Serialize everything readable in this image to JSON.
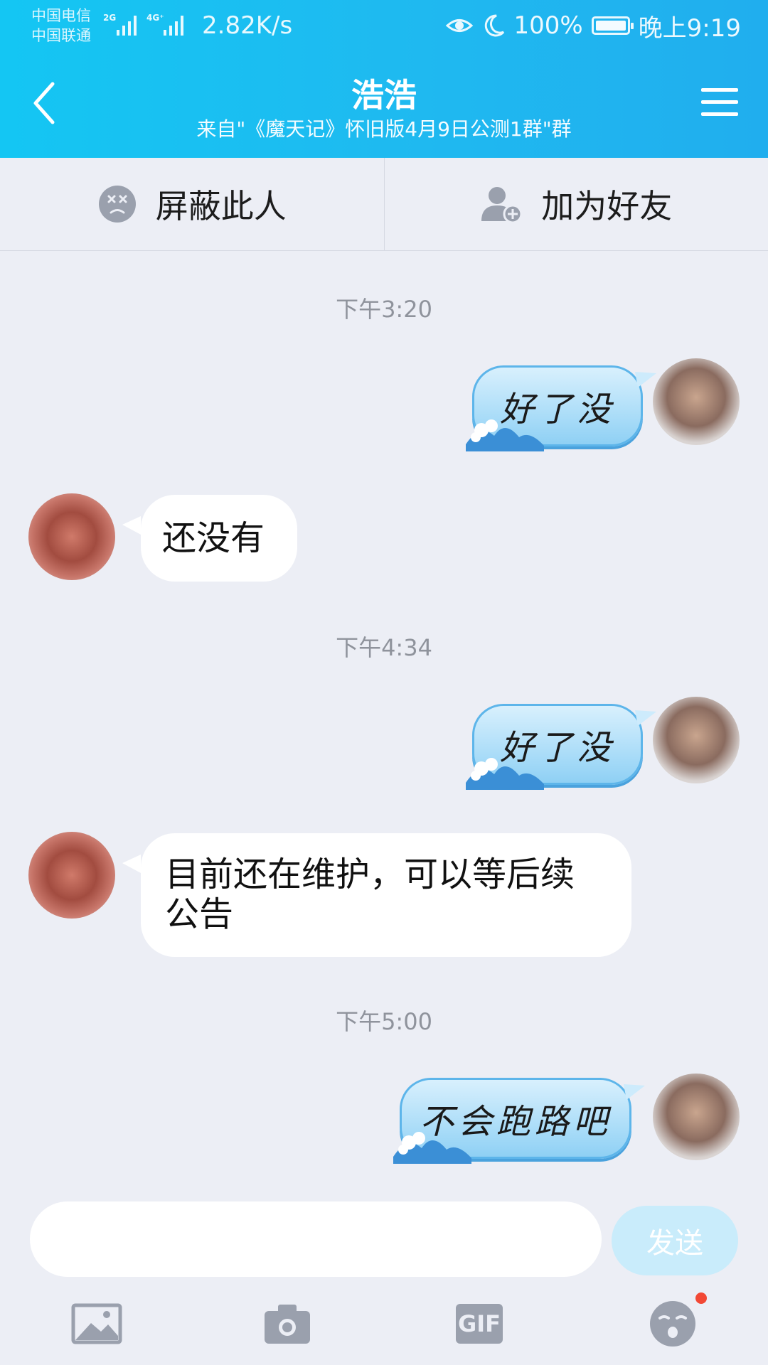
{
  "status_bar": {
    "carrier1": "中国电信",
    "carrier2": "中国联通",
    "net1": "2G",
    "net2": "4G⁺",
    "speed": "2.82K/s",
    "battery": "100%",
    "time": "晚上9:19"
  },
  "nav": {
    "title": "浩浩",
    "subtitle": "来自\"《魔天记》怀旧版4月9日公测1群\"群"
  },
  "actions": {
    "block": "屏蔽此人",
    "add_friend": "加为好友"
  },
  "messages": [
    {
      "time": "下午3:20"
    },
    {
      "side": "right",
      "text": "好了没"
    },
    {
      "side": "left",
      "text": "还没有"
    },
    {
      "time": "下午4:34"
    },
    {
      "side": "right",
      "text": "好了没"
    },
    {
      "side": "left",
      "text": "目前还在维护，可以等后续公告"
    },
    {
      "time": "下午5:00"
    },
    {
      "side": "right",
      "text": "不会跑路吧"
    }
  ],
  "input": {
    "value": "",
    "send_label": "发送"
  },
  "toolbar": {
    "items": [
      "image-icon",
      "camera-icon",
      "gif-icon",
      "emoji-icon"
    ],
    "gif_label": "GIF"
  },
  "colors": {
    "header": "#1fb9f0",
    "badge": "#f24835",
    "send_disabled": "#c9ecfb"
  }
}
